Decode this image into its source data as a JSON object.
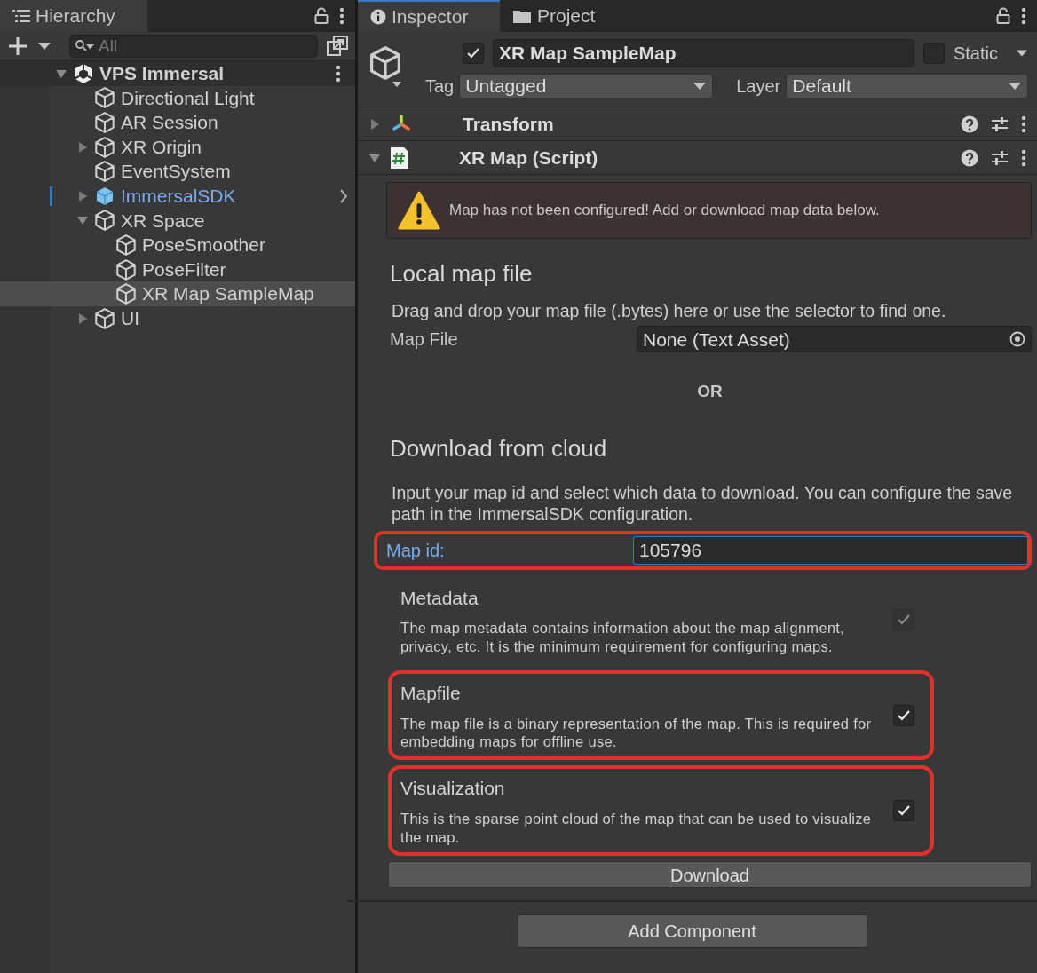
{
  "hierarchy": {
    "title": "Hierarchy",
    "search": {
      "placeholder": "All"
    },
    "tree": [
      {
        "name": "VPS Immersal",
        "kind": "scene",
        "expanded": true,
        "selected": false,
        "children": [
          {
            "name": "Directional Light",
            "kind": "object",
            "selected": false
          },
          {
            "name": "AR Session",
            "kind": "object",
            "selected": false
          },
          {
            "name": "XR Origin",
            "kind": "object",
            "expanded": false,
            "selected": false
          },
          {
            "name": "EventSystem",
            "kind": "object",
            "selected": false
          },
          {
            "name": "ImmersalSDK",
            "kind": "prefab",
            "expanded": false,
            "selected": false
          },
          {
            "name": "XR Space",
            "kind": "object",
            "expanded": true,
            "selected": false,
            "children": [
              {
                "name": "PoseSmoother",
                "kind": "object",
                "selected": false
              },
              {
                "name": "PoseFilter",
                "kind": "object",
                "selected": false
              },
              {
                "name": "XR Map SampleMap",
                "kind": "object",
                "selected": true
              }
            ]
          },
          {
            "name": "UI",
            "kind": "object",
            "expanded": false,
            "selected": false
          }
        ]
      }
    ]
  },
  "tabs": [
    {
      "label": "Inspector",
      "kind": "info",
      "selected": true
    },
    {
      "label": "Project",
      "kind": "folder",
      "selected": false
    }
  ],
  "object": {
    "active": true,
    "name": "XR Map SampleMap",
    "static_label": "Static",
    "static": false,
    "tag_label": "Tag",
    "tag": "Untagged",
    "layer_label": "Layer",
    "layer": "Default"
  },
  "components": [
    {
      "name": "Transform",
      "kind": "transform",
      "expanded": false
    },
    {
      "name": "XR Map (Script)",
      "kind": "script",
      "expanded": true
    }
  ],
  "warning": "Map has not been configured! Add or download map data below.",
  "local": {
    "heading": "Local map file",
    "text": "Drag and drop your map file (.bytes) here or use the selector to find one.",
    "field_label": "Map File",
    "field_value": "None (Text Asset)"
  },
  "or_label": "OR",
  "cloud": {
    "heading": "Download from cloud",
    "text": "Input your map id and select which data to download. You can configure the save path in the ImmersalSDK configuration.",
    "id_label": "Map id:",
    "id_value": "105796",
    "highlighted": true,
    "options": [
      {
        "title": "Metadata",
        "text": "The map metadata contains information about the map alignment, privacy, etc. It is the minimum requirement for configuring maps.",
        "checked": true,
        "disabled": true,
        "highlighted": false
      },
      {
        "title": "Mapfile",
        "text": "The map file is a binary representation of the map. This is required for embedding maps for offline use.",
        "checked": true,
        "disabled": false,
        "highlighted": true
      },
      {
        "title": "Visualization",
        "text": "This is the sparse point cloud of the map that can be used to visualize the map.",
        "checked": true,
        "disabled": false,
        "highlighted": true
      }
    ],
    "button": "Download"
  },
  "add_button": "Add Component"
}
